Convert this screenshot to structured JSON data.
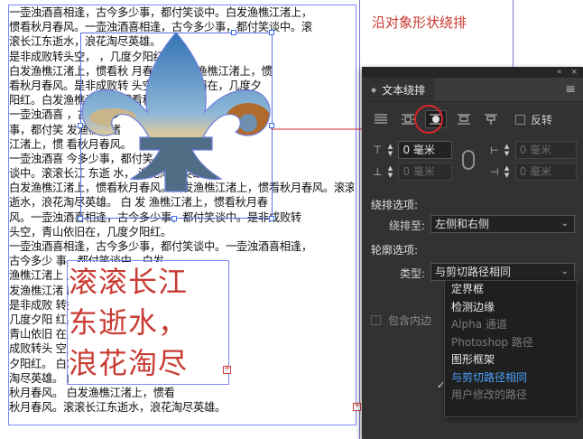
{
  "annotation": "沿对象形状绕排",
  "page_lines": [
    "一壶浊酒喜相逢，古今多少事，都付笑谈中。白发渔樵江渚上，",
    "惯看秋月春风。一壶浊酒喜相逢，古今多少事，都付笑谈中。滚",
    "滚长江东逝水，浪花淘尽英雄。",
    "是非成败转头空，                               ，几度夕阳红。",
    "白发渔樵江渚上，惯看秋                    月春风。白发渔樵江渚上，惯",
    "看秋月春风。是非成败转                头空，青山依旧在，几度夕",
    "阳红。白发渔樵江                            上，惯看秋月春风。",
    "一壶浊酒喜                                                     ，古今多少",
    "事，都付笑                                                      发渔樵江渚",
    "江渚上，惯                                                  看秋月春风。",
    "一壶浊酒喜                                    今多少事，都付笑",
    "谈中。滚滚长江  东逝                   水，  浪花淘尽英雄。",
    "白发渔樵江渚上，惯看秋月春风。白发渔樵江渚上，惯看秋月春风。滚滚长江东",
    "逝水，浪花淘尽英雄。  白     发   渔樵江渚上，惯看秋月春",
    "风。一壶浊酒喜相逢，古今多少事，都付笑谈中。是非成败转",
    "头空，青山依旧在，几度夕阳红。",
    "一壶浊酒喜相逢，古今多少事，都付笑谈中。一壶浊酒喜相逢，",
    "古今多少                          事，都付笑谈中。白发",
    "渔樵江渚上                        上，惯看秋月春风。白",
    "发渔樵江渚                        风。是非成败转头空，",
    "是非成败                           转头空，青山依旧在，",
    "几度夕阳                            红。是非成败转头空，",
    "青山依旧                            在，几度夕阳红。是非",
    "成败转头                            空，青山依旧在，几度",
    "夕阳红。                            白发渔樵江渚上，惯看",
    "淘尽英雄。                         白发渔樵江渚上，惯看",
    "秋月春风。                          白发渔樵江渚上，惯看",
    "秋月春风。滚滚长江东逝水，浪花淘尽英雄。"
  ],
  "big_text": [
    "滚滚长江",
    "东逝水，",
    "浪花淘尽"
  ],
  "panel": {
    "tab_label": "文本绕排",
    "collapse_glyph": "«",
    "close_glyph": "×",
    "menu_glyph": "≡",
    "wrap_modes": [
      "no-wrap-icon",
      "bounding-box-wrap-icon",
      "object-shape-wrap-icon",
      "jump-object-icon",
      "jump-next-column-icon"
    ],
    "invert_label": "反转",
    "top_offset": "0 毫米",
    "bottom_offset": "0 毫米",
    "left_offset": "0 毫米",
    "right_offset": "0 毫米",
    "wrap_options_label": "绕排选项:",
    "wrap_to_label": "绕排至:",
    "wrap_to_value": "左侧和右侧",
    "contour_options_label": "轮廓选项:",
    "type_label": "类型:",
    "type_value": "与剪切路径相同",
    "include_inside_label": "包含内边",
    "type_options": [
      {
        "label": "定界框",
        "state": "enabled"
      },
      {
        "label": "检测边缘",
        "state": "enabled"
      },
      {
        "label": "Alpha 通道",
        "state": "disabled"
      },
      {
        "label": "Photoshop 路径",
        "state": "disabled"
      },
      {
        "label": "图形框架",
        "state": "enabled"
      },
      {
        "label": "与剪切路径相同",
        "state": "selected"
      },
      {
        "label": "用户修改的路径",
        "state": "disabled"
      }
    ]
  }
}
